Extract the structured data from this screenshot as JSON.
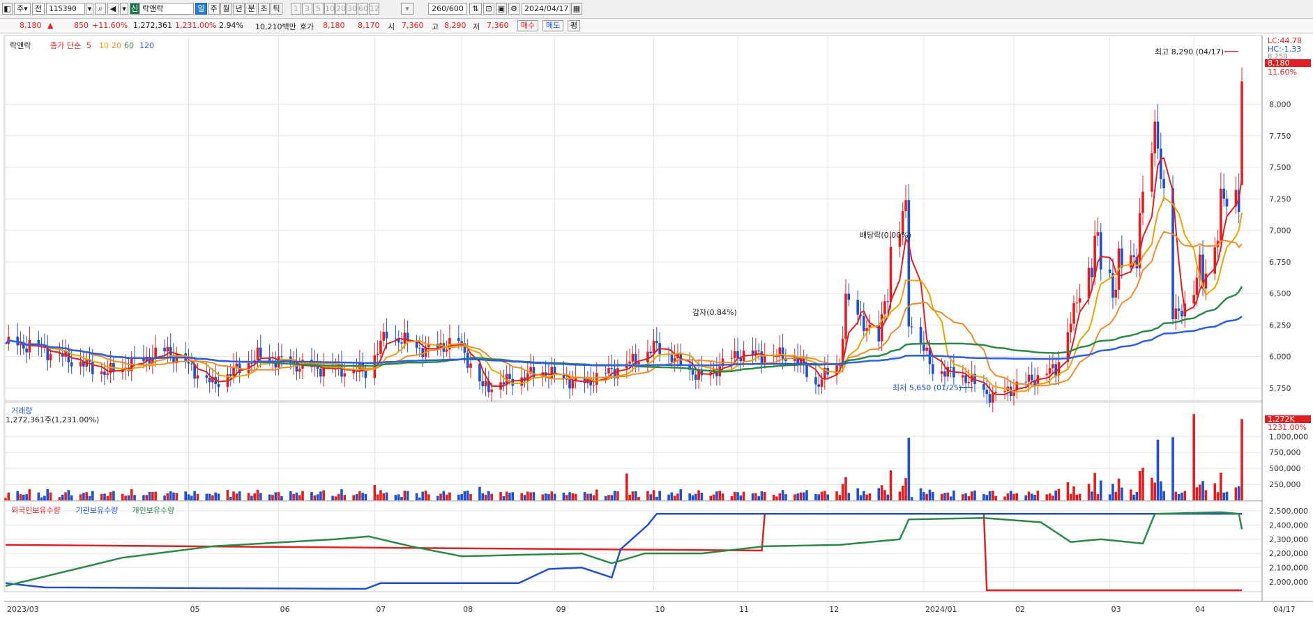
{
  "toolbar": {
    "mode1": "주",
    "mode2": "전",
    "stock_code": "115390",
    "stock_badge": "신",
    "stock_name": "락앤락",
    "periods": [
      "일",
      "주",
      "월",
      "년",
      "분",
      "초",
      "틱"
    ],
    "active_period": "일",
    "intervals": [
      "1",
      "3",
      "5",
      "10",
      "20",
      "30",
      "60",
      "120"
    ],
    "count": "260",
    "count_total": "/600",
    "date": "2024/04/17"
  },
  "quote": {
    "price": "8,180",
    "change": "850",
    "change_pct": "+11.60%",
    "volume": "1,272,361",
    "volume_ratio": "1,231.00%",
    "turnover": "2.94%",
    "amount": "10,210백만",
    "ask_label": "호가",
    "ask1": "8,180",
    "ask2": "8,170",
    "open_label": "시",
    "open": "7,360",
    "high_label": "고",
    "high": "8,290",
    "low_label": "저",
    "low": "7,360",
    "buy_label": "매수",
    "sell_label": "매도",
    "flat_label": "평"
  },
  "chart_data": [
    {
      "type": "candlestick",
      "panel": "price",
      "name": "락앤락",
      "legend_label": "락앤락",
      "ma_label": "종가 단순",
      "ma_periods": [
        "5",
        "10",
        "20",
        "60",
        "120"
      ],
      "ylim": [
        5650,
        8500
      ],
      "yticks": [
        "5,750",
        "6,000",
        "6,250",
        "6,500",
        "6,750",
        "7,000",
        "7,250",
        "7,500",
        "7,750",
        "8,000"
      ],
      "right_labels": {
        "lc": "LC:44.78",
        "hc": "HC:-1.33",
        "top_tick": "8,250",
        "last_price": "8,180",
        "last_pct": "11.60%"
      },
      "annotations": {
        "high": "최고 8,290 (04/17)",
        "low": "최저 5,650 (01/25)",
        "capital_reduction": "감자(0.84%)",
        "dividend": "배당락(0.00%)"
      },
      "ohlc_keypoints": [
        [
          "2023/03/02",
          6100
        ],
        [
          "2023/03/10",
          6090
        ],
        [
          "2023/04/05",
          5870
        ],
        [
          "2023/04/25",
          6050
        ],
        [
          "2023/05/10",
          5780
        ],
        [
          "2023/05/25",
          6000
        ],
        [
          "2023/06/10",
          5920
        ],
        [
          "2023/06/30",
          5880
        ],
        [
          "2023/07/07",
          6180
        ],
        [
          "2023/07/20",
          6050
        ],
        [
          "2023/07/31",
          6120
        ],
        [
          "2023/08/08",
          5750
        ],
        [
          "2023/08/28",
          5880
        ],
        [
          "2023/09/10",
          5780
        ],
        [
          "2023/09/27",
          5960
        ],
        [
          "2023/10/05",
          6080
        ],
        [
          "2023/10/20",
          5830
        ],
        [
          "2023/11/01",
          6020
        ],
        [
          "2023/11/10",
          6010
        ],
        [
          "2023/11/20",
          6000
        ],
        [
          "2023/11/27",
          5780
        ],
        [
          "2023/12/05",
          5950
        ],
        [
          "2023/12/07",
          6450
        ],
        [
          "2023/12/12",
          6300
        ],
        [
          "2023/12/18",
          6120
        ],
        [
          "2023/12/22",
          6800
        ],
        [
          "2023/12/27",
          7100
        ],
        [
          "2023/12/28",
          6300
        ],
        [
          "2024/01/05",
          5900
        ],
        [
          "2024/01/15",
          5850
        ],
        [
          "2024/01/25",
          5680
        ],
        [
          "2024/02/05",
          5800
        ],
        [
          "2024/02/15",
          5900
        ],
        [
          "2024/02/23",
          6500
        ],
        [
          "2024/02/28",
          6850
        ],
        [
          "2024/03/05",
          6600
        ],
        [
          "2024/03/12",
          6800
        ],
        [
          "2024/03/15",
          7200
        ],
        [
          "2024/03/20",
          7850
        ],
        [
          "2024/03/25",
          6300
        ],
        [
          "2024/04/01",
          6500
        ],
        [
          "2024/04/08",
          6900
        ],
        [
          "2024/04/12",
          7300
        ],
        [
          "2024/04/16",
          7330
        ],
        [
          "2024/04/17",
          8180
        ]
      ],
      "last_candle": {
        "open": 7360,
        "high": 8290,
        "low": 7360,
        "close": 8180
      }
    },
    {
      "type": "bar",
      "panel": "volume",
      "title": "거래량",
      "subtitle": "1,272,361주(1,231.00%)",
      "yticks": [
        "250,000",
        "500,000",
        "750,000",
        "1,000,000"
      ],
      "right_labels": {
        "last": "1,272K",
        "last_pct": "1231.00%"
      },
      "notable_bars": [
        {
          "date": "2023/09/25",
          "value": 420000
        },
        {
          "date": "2023/12/27",
          "value": 350000
        },
        {
          "date": "2024/02/28",
          "value": 430000
        },
        {
          "date": "2024/03/15",
          "value": 510000
        },
        {
          "date": "2024/03/20",
          "value": 950000
        },
        {
          "date": "2024/04/01",
          "value": 1350000
        },
        {
          "date": "2024/04/17",
          "value": 1272361
        }
      ]
    },
    {
      "type": "line",
      "panel": "holdings",
      "series": [
        {
          "name": "외국인보유수량",
          "color": "#e02020",
          "points": [
            [
              "2023/03/02",
              2260000
            ],
            [
              "2023/11/09",
              2220000
            ],
            [
              "2023/11/10",
              2480000
            ],
            [
              "2024/01/22",
              2480000
            ],
            [
              "2024/01/23",
              1940000
            ],
            [
              "2024/04/17",
              1940000
            ]
          ]
        },
        {
          "name": "기관보유수량",
          "color": "#1e50d0",
          "points": [
            [
              "2023/03/02",
              1990000
            ],
            [
              "2023/03/15",
              1960000
            ],
            [
              "2023/06/30",
              1950000
            ],
            [
              "2023/07/05",
              1990000
            ],
            [
              "2023/08/20",
              1990000
            ],
            [
              "2023/08/30",
              2090000
            ],
            [
              "2023/09/10",
              2100000
            ],
            [
              "2023/09/20",
              2030000
            ],
            [
              "2023/09/23",
              2230000
            ],
            [
              "2023/10/02",
              2400000
            ],
            [
              "2023/10/05",
              2480000
            ],
            [
              "2024/04/17",
              2480000
            ]
          ]
        },
        {
          "name": "개인보유수량",
          "color": "#2b8a45",
          "points": [
            [
              "2023/03/02",
              1970000
            ],
            [
              "2023/04/10",
              2170000
            ],
            [
              "2023/05/10",
              2250000
            ],
            [
              "2023/06/20",
              2300000
            ],
            [
              "2023/07/01",
              2320000
            ],
            [
              "2023/07/15",
              2250000
            ],
            [
              "2023/08/01",
              2180000
            ],
            [
              "2023/09/10",
              2200000
            ],
            [
              "2023/09/20",
              2130000
            ],
            [
              "2023/10/01",
              2200000
            ],
            [
              "2023/10/20",
              2200000
            ],
            [
              "2023/11/10",
              2250000
            ],
            [
              "2023/12/05",
              2260000
            ],
            [
              "2023/12/25",
              2300000
            ],
            [
              "2023/12/28",
              2440000
            ],
            [
              "2024/01/22",
              2450000
            ],
            [
              "2024/02/10",
              2420000
            ],
            [
              "2024/02/20",
              2280000
            ],
            [
              "2024/03/01",
              2300000
            ],
            [
              "2024/03/15",
              2270000
            ],
            [
              "2024/03/19",
              2480000
            ],
            [
              "2024/04/10",
              2490000
            ],
            [
              "2024/04/16",
              2480000
            ],
            [
              "2024/04/17",
              2370000
            ]
          ]
        }
      ],
      "yticks": [
        "2,000,000",
        "2,100,000",
        "2,200,000",
        "2,300,000",
        "2,400,000",
        "2,500,000"
      ]
    }
  ],
  "x_axis": {
    "ticks": [
      {
        "date": "2023/03/02",
        "label": "2023/03"
      },
      {
        "date": "2023/05/02",
        "label": "05"
      },
      {
        "date": "2023/06/01",
        "label": "06"
      },
      {
        "date": "2023/07/03",
        "label": "07"
      },
      {
        "date": "2023/08/01",
        "label": "08"
      },
      {
        "date": "2023/09/01",
        "label": "09"
      },
      {
        "date": "2023/10/04",
        "label": "10"
      },
      {
        "date": "2023/11/01",
        "label": "11"
      },
      {
        "date": "2023/12/01",
        "label": "12"
      },
      {
        "date": "2024/01/02",
        "label": "2024/01"
      },
      {
        "date": "2024/02/01",
        "label": "02"
      },
      {
        "date": "2024/03/04",
        "label": "03"
      },
      {
        "date": "2024/04/01",
        "label": "04"
      }
    ],
    "end_label": "04/17"
  },
  "colors": {
    "up": "#e02020",
    "down": "#1e50d0",
    "ma5": "#e02020",
    "ma10": "#f0a000",
    "ma20": "#f08c28",
    "ma60": "#2b8a45",
    "ma120": "#2c5ee8",
    "grid": "#e4e4e4"
  }
}
